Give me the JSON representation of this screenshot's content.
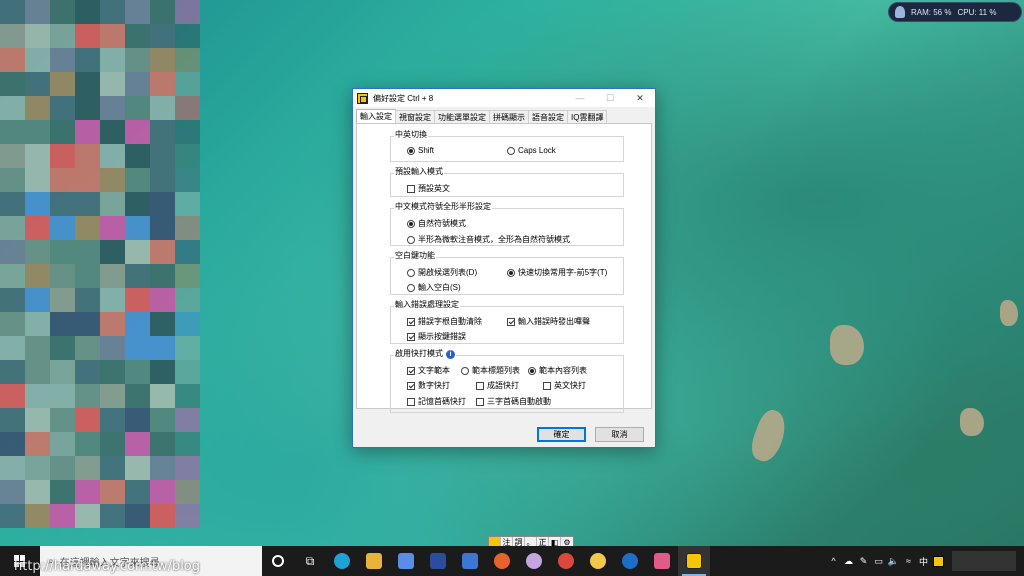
{
  "system_monitor": {
    "ram_label": "RAM: 56 %",
    "cpu_label": "CPU: 11 %"
  },
  "dialog": {
    "title": "偏好設定 Ctrl + 8",
    "tabs": [
      "輸入設定",
      "視窗設定",
      "功能選單設定",
      "拼碼顯示",
      "語音設定",
      "IQ雲翻譯"
    ],
    "groups": {
      "switch": {
        "label": "中英切換",
        "options": [
          {
            "label": "Shift",
            "selected": true
          },
          {
            "label": "Caps Lock",
            "selected": false
          }
        ]
      },
      "default_mode": {
        "label": "預設輸入模式",
        "options": [
          {
            "label": "預設英文",
            "checked": false
          }
        ]
      },
      "fullhalf": {
        "label": "中文模式符號全形半形設定",
        "options": [
          {
            "label": "自然符號模式",
            "selected": true
          },
          {
            "label": "半形為微軟注音模式，全形為自然符號模式",
            "selected": false
          }
        ]
      },
      "space": {
        "label": "空白鍵功能",
        "options": [
          {
            "label": "開啟候選列表(D)",
            "selected": false
          },
          {
            "label": "快速切換常用字-前5字(T)",
            "selected": true
          },
          {
            "label": "輸入空白(S)",
            "selected": false
          }
        ]
      },
      "error": {
        "label": "輸入錯誤處理設定",
        "options": [
          {
            "label": "錯誤字根自動清除",
            "checked": true
          },
          {
            "label": "輸入錯誤時發出嗶聲",
            "checked": true
          },
          {
            "label": "顯示按鍵錯誤",
            "checked": true
          }
        ]
      },
      "quick": {
        "label": "啟用快打模式",
        "options": [
          {
            "label": "文字範本",
            "checked": true
          },
          {
            "label": "範本標題列表",
            "selected": false
          },
          {
            "label": "範本內容列表",
            "selected": true
          },
          {
            "label": "數字快打",
            "checked": true
          },
          {
            "label": "成語快打",
            "checked": false
          },
          {
            "label": "英文快打",
            "checked": false
          },
          {
            "label": "記憶首碼快打",
            "checked": false
          },
          {
            "label": "三字首碼自動啟動",
            "checked": false
          }
        ]
      }
    },
    "ok_label": "確定",
    "cancel_label": "取消"
  },
  "ime_bar": [
    "注",
    "詞",
    "。",
    "正"
  ],
  "taskbar": {
    "search_placeholder": "在這裡輸入文字來搜尋",
    "tray_lang": "中",
    "tray_ime": "8"
  },
  "watermark": "http://hardaway.com.tw/blog"
}
